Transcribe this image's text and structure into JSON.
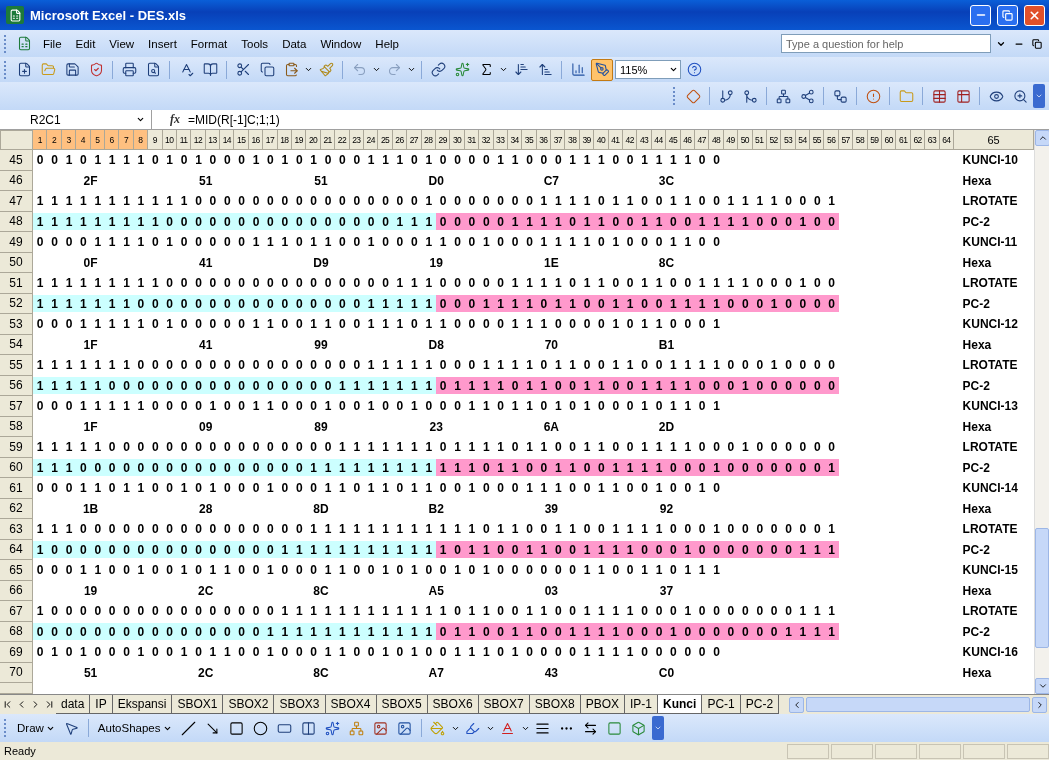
{
  "window": {
    "title": "Microsoft Excel - DES.xls"
  },
  "menu": [
    "File",
    "Edit",
    "View",
    "Insert",
    "Format",
    "Tools",
    "Data",
    "Window",
    "Help"
  ],
  "help_search": {
    "placeholder": "Type a question for help"
  },
  "toolbar": {
    "zoom": "115%"
  },
  "formula_bar": {
    "name_box": "R2C1",
    "function_button": "fx",
    "formula": "=MID(R[-1]C;1;1)"
  },
  "column_headers": [
    {
      "label": "1",
      "selected": true
    },
    {
      "label": "2",
      "selected": true
    },
    {
      "label": "3",
      "selected": true
    },
    {
      "label": "4",
      "selected": true
    },
    {
      "label": "5",
      "selected": true
    },
    {
      "label": "6",
      "selected": true
    },
    {
      "label": "7",
      "selected": true
    },
    {
      "label": "8",
      "selected": true
    },
    {
      "label": "9",
      "selected": false
    },
    {
      "label": "10",
      "selected": false
    },
    {
      "label": "11",
      "selected": false
    },
    {
      "label": "12",
      "selected": false
    },
    {
      "label": "13",
      "selected": false
    },
    {
      "label": "14",
      "selected": false
    },
    {
      "label": "15",
      "selected": false
    },
    {
      "label": "16",
      "selected": false
    },
    {
      "label": "17",
      "selected": false
    },
    {
      "label": "18",
      "selected": false
    },
    {
      "label": "19",
      "selected": false
    },
    {
      "label": "20",
      "selected": false
    },
    {
      "label": "21",
      "selected": false
    },
    {
      "label": "22",
      "selected": false
    },
    {
      "label": "23",
      "selected": false
    },
    {
      "label": "24",
      "selected": false
    },
    {
      "label": "25",
      "selected": false
    },
    {
      "label": "26",
      "selected": false
    },
    {
      "label": "27",
      "selected": false
    },
    {
      "label": "28",
      "selected": false
    },
    {
      "label": "29",
      "selected": false
    },
    {
      "label": "30",
      "selected": false
    },
    {
      "label": "31",
      "selected": false
    },
    {
      "label": "32",
      "selected": false
    },
    {
      "label": "33",
      "selected": false
    },
    {
      "label": "34",
      "selected": false
    },
    {
      "label": "35",
      "selected": false
    },
    {
      "label": "36",
      "selected": false
    },
    {
      "label": "37",
      "selected": false
    },
    {
      "label": "38",
      "selected": false
    },
    {
      "label": "39",
      "selected": false
    },
    {
      "label": "40",
      "selected": false
    },
    {
      "label": "41",
      "selected": false
    },
    {
      "label": "42",
      "selected": false
    },
    {
      "label": "43",
      "selected": false
    },
    {
      "label": "44",
      "selected": false
    },
    {
      "label": "45",
      "selected": false
    },
    {
      "label": "46",
      "selected": false
    },
    {
      "label": "47",
      "selected": false
    },
    {
      "label": "48",
      "selected": false
    },
    {
      "label": "49",
      "selected": false
    },
    {
      "label": "50",
      "selected": false
    },
    {
      "label": "51",
      "selected": false
    },
    {
      "label": "52",
      "selected": false
    },
    {
      "label": "53",
      "selected": false
    },
    {
      "label": "54",
      "selected": false
    },
    {
      "label": "55",
      "selected": false
    },
    {
      "label": "56",
      "selected": false
    },
    {
      "label": "57",
      "selected": false
    },
    {
      "label": "58",
      "selected": false
    },
    {
      "label": "59",
      "selected": false
    },
    {
      "label": "60",
      "selected": false
    },
    {
      "label": "61",
      "selected": false
    },
    {
      "label": "62",
      "selected": false
    },
    {
      "label": "63",
      "selected": false
    },
    {
      "label": "64",
      "selected": false
    },
    {
      "label": "65",
      "selected": false
    }
  ],
  "rows": [
    {
      "number": "45",
      "kind": "bits",
      "label": "KUNCI-10",
      "groups": [
        {
          "cells": [
            "0",
            "0",
            "1",
            "0",
            "1",
            "1",
            "1",
            "1",
            "0",
            "1",
            "0",
            "1",
            "0",
            "0",
            "0",
            "1",
            "0",
            "1",
            "0",
            "1",
            "0",
            "0",
            "0",
            "1",
            "1",
            "1",
            "0",
            "1",
            "0",
            "0",
            "0",
            "0",
            "1",
            "1",
            "0",
            "0",
            "0",
            "1",
            "1",
            "1",
            "0",
            "0",
            "1",
            "1",
            "1",
            "1",
            "0",
            "0"
          ]
        }
      ]
    },
    {
      "number": "46",
      "kind": "hex",
      "label": "Hexa",
      "values": [
        "2F",
        "51",
        "51",
        "D0",
        "C7",
        "3C"
      ]
    },
    {
      "number": "47",
      "kind": "bits",
      "label": "LROTATE",
      "groups": [
        {
          "cells": [
            "1",
            "1",
            "1",
            "1",
            "1",
            "1",
            "1",
            "1",
            "1",
            "1",
            "1",
            "0",
            "0",
            "0",
            "0",
            "0",
            "0",
            "0",
            "0",
            "0",
            "0",
            "0",
            "0",
            "0",
            "0",
            "0",
            "0",
            "1",
            "0",
            "0",
            "0",
            "0",
            "0",
            "0",
            "0",
            "1",
            "1",
            "1",
            "1",
            "0",
            "1",
            "1",
            "0",
            "0",
            "1",
            "1",
            "0",
            "0",
            "1",
            "1",
            "1",
            "1",
            "0",
            "0",
            "0",
            "1"
          ]
        }
      ]
    },
    {
      "number": "48",
      "kind": "bits",
      "label": "PC-2",
      "groups": [
        {
          "color": "#ccffff",
          "cells": [
            "1",
            "1",
            "1",
            "1",
            "1",
            "1",
            "1",
            "1",
            "1",
            "0",
            "0",
            "0",
            "0",
            "0",
            "0",
            "0",
            "0",
            "0",
            "0",
            "0",
            "0",
            "0",
            "0",
            "0",
            "0",
            "1",
            "1",
            "1"
          ]
        },
        {
          "color": "#ff99cc",
          "cells": [
            "0",
            "0",
            "0",
            "0",
            "0",
            "1",
            "1",
            "1",
            "1",
            "0",
            "1",
            "1",
            "0",
            "0",
            "1",
            "1",
            "0",
            "0",
            "1",
            "1",
            "1",
            "1",
            "0",
            "0",
            "0",
            "1",
            "0",
            "0"
          ]
        }
      ]
    },
    {
      "number": "49",
      "kind": "bits",
      "label": "KUNCI-11",
      "groups": [
        {
          "cells": [
            "0",
            "0",
            "0",
            "0",
            "1",
            "1",
            "1",
            "1",
            "0",
            "1",
            "0",
            "0",
            "0",
            "0",
            "0",
            "1",
            "1",
            "1",
            "0",
            "1",
            "1",
            "0",
            "0",
            "1",
            "0",
            "0",
            "0",
            "1",
            "1",
            "0",
            "0",
            "1",
            "0",
            "0",
            "0",
            "1",
            "1",
            "1",
            "1",
            "0",
            "1",
            "0",
            "0",
            "0",
            "1",
            "1",
            "0",
            "0"
          ]
        }
      ]
    },
    {
      "number": "50",
      "kind": "hex",
      "label": "Hexa",
      "values": [
        "0F",
        "41",
        "D9",
        "19",
        "1E",
        "8C"
      ]
    },
    {
      "number": "51",
      "kind": "bits",
      "label": "LROTATE",
      "groups": [
        {
          "cells": [
            "1",
            "1",
            "1",
            "1",
            "1",
            "1",
            "1",
            "1",
            "1",
            "0",
            "0",
            "0",
            "0",
            "0",
            "0",
            "0",
            "0",
            "0",
            "0",
            "0",
            "0",
            "0",
            "0",
            "0",
            "0",
            "1",
            "1",
            "1",
            "0",
            "0",
            "0",
            "0",
            "0",
            "1",
            "1",
            "1",
            "1",
            "0",
            "1",
            "1",
            "0",
            "0",
            "1",
            "1",
            "0",
            "0",
            "1",
            "1",
            "1",
            "1",
            "0",
            "0",
            "0",
            "1",
            "0",
            "0"
          ]
        }
      ]
    },
    {
      "number": "52",
      "kind": "bits",
      "label": "PC-2",
      "groups": [
        {
          "color": "#ccffff",
          "cells": [
            "1",
            "1",
            "1",
            "1",
            "1",
            "1",
            "1",
            "0",
            "0",
            "0",
            "0",
            "0",
            "0",
            "0",
            "0",
            "0",
            "0",
            "0",
            "0",
            "0",
            "0",
            "0",
            "0",
            "1",
            "1",
            "1",
            "1",
            "1"
          ]
        },
        {
          "color": "#ff99cc",
          "cells": [
            "0",
            "0",
            "0",
            "1",
            "1",
            "1",
            "1",
            "0",
            "1",
            "1",
            "0",
            "0",
            "1",
            "1",
            "0",
            "0",
            "1",
            "1",
            "1",
            "1",
            "0",
            "0",
            "0",
            "1",
            "0",
            "0",
            "0",
            "0"
          ]
        }
      ]
    },
    {
      "number": "53",
      "kind": "bits",
      "label": "KUNCI-12",
      "groups": [
        {
          "cells": [
            "0",
            "0",
            "0",
            "1",
            "1",
            "1",
            "1",
            "1",
            "0",
            "1",
            "0",
            "0",
            "0",
            "0",
            "0",
            "1",
            "1",
            "0",
            "0",
            "1",
            "1",
            "0",
            "0",
            "1",
            "1",
            "1",
            "0",
            "1",
            "1",
            "0",
            "0",
            "0",
            "0",
            "1",
            "1",
            "1",
            "0",
            "0",
            "0",
            "0",
            "1",
            "0",
            "1",
            "1",
            "0",
            "0",
            "0",
            "1"
          ]
        }
      ]
    },
    {
      "number": "54",
      "kind": "hex",
      "label": "Hexa",
      "values": [
        "1F",
        "41",
        "99",
        "D8",
        "70",
        "B1"
      ]
    },
    {
      "number": "55",
      "kind": "bits",
      "label": "LROTATE",
      "groups": [
        {
          "cells": [
            "1",
            "1",
            "1",
            "1",
            "1",
            "1",
            "1",
            "0",
            "0",
            "0",
            "0",
            "0",
            "0",
            "0",
            "0",
            "0",
            "0",
            "0",
            "0",
            "0",
            "0",
            "0",
            "0",
            "1",
            "1",
            "1",
            "1",
            "1",
            "0",
            "0",
            "0",
            "1",
            "1",
            "1",
            "1",
            "0",
            "1",
            "1",
            "0",
            "0",
            "1",
            "1",
            "0",
            "0",
            "1",
            "1",
            "1",
            "1",
            "0",
            "0",
            "0",
            "1",
            "0",
            "0",
            "0",
            "0"
          ]
        }
      ]
    },
    {
      "number": "56",
      "kind": "bits",
      "label": "PC-2",
      "groups": [
        {
          "color": "#ccffff",
          "cells": [
            "1",
            "1",
            "1",
            "1",
            "1",
            "0",
            "0",
            "0",
            "0",
            "0",
            "0",
            "0",
            "0",
            "0",
            "0",
            "0",
            "0",
            "0",
            "0",
            "0",
            "0",
            "1",
            "1",
            "1",
            "1",
            "1",
            "1",
            "1"
          ]
        },
        {
          "color": "#ff99cc",
          "cells": [
            "0",
            "1",
            "1",
            "1",
            "1",
            "0",
            "1",
            "1",
            "0",
            "0",
            "1",
            "1",
            "0",
            "0",
            "1",
            "1",
            "1",
            "1",
            "0",
            "0",
            "0",
            "1",
            "0",
            "0",
            "0",
            "0",
            "0",
            "0"
          ]
        }
      ]
    },
    {
      "number": "57",
      "kind": "bits",
      "label": "KUNCI-13",
      "groups": [
        {
          "cells": [
            "0",
            "0",
            "0",
            "1",
            "1",
            "1",
            "1",
            "1",
            "0",
            "0",
            "0",
            "0",
            "1",
            "0",
            "0",
            "1",
            "1",
            "0",
            "0",
            "0",
            "1",
            "0",
            "0",
            "1",
            "0",
            "0",
            "1",
            "0",
            "0",
            "0",
            "1",
            "1",
            "0",
            "1",
            "1",
            "0",
            "1",
            "0",
            "1",
            "0",
            "0",
            "0",
            "1",
            "0",
            "1",
            "1",
            "0",
            "1"
          ]
        }
      ]
    },
    {
      "number": "58",
      "kind": "hex",
      "label": "Hexa",
      "values": [
        "1F",
        "09",
        "89",
        "23",
        "6A",
        "2D"
      ]
    },
    {
      "number": "59",
      "kind": "bits",
      "label": "LROTATE",
      "groups": [
        {
          "cells": [
            "1",
            "1",
            "1",
            "1",
            "1",
            "0",
            "0",
            "0",
            "0",
            "0",
            "0",
            "0",
            "0",
            "0",
            "0",
            "0",
            "0",
            "0",
            "0",
            "0",
            "0",
            "1",
            "1",
            "1",
            "1",
            "1",
            "1",
            "1",
            "0",
            "1",
            "1",
            "1",
            "1",
            "0",
            "1",
            "1",
            "0",
            "0",
            "1",
            "1",
            "0",
            "0",
            "1",
            "1",
            "1",
            "1",
            "0",
            "0",
            "0",
            "1",
            "0",
            "0",
            "0",
            "0",
            "0",
            "0"
          ]
        }
      ]
    },
    {
      "number": "60",
      "kind": "bits",
      "label": "PC-2",
      "groups": [
        {
          "color": "#ccffff",
          "cells": [
            "1",
            "1",
            "1",
            "0",
            "0",
            "0",
            "0",
            "0",
            "0",
            "0",
            "0",
            "0",
            "0",
            "0",
            "0",
            "0",
            "0",
            "0",
            "0",
            "1",
            "1",
            "1",
            "1",
            "1",
            "1",
            "1",
            "1",
            "1"
          ]
        },
        {
          "color": "#ff99cc",
          "cells": [
            "1",
            "1",
            "1",
            "0",
            "1",
            "1",
            "0",
            "0",
            "1",
            "1",
            "0",
            "0",
            "1",
            "1",
            "1",
            "1",
            "0",
            "0",
            "0",
            "1",
            "0",
            "0",
            "0",
            "0",
            "0",
            "0",
            "0",
            "1"
          ]
        }
      ]
    },
    {
      "number": "61",
      "kind": "bits",
      "label": "KUNCI-14",
      "groups": [
        {
          "cells": [
            "0",
            "0",
            "0",
            "1",
            "1",
            "0",
            "1",
            "1",
            "0",
            "0",
            "1",
            "0",
            "1",
            "0",
            "0",
            "0",
            "1",
            "0",
            "0",
            "0",
            "1",
            "1",
            "0",
            "1",
            "1",
            "0",
            "1",
            "1",
            "0",
            "0",
            "1",
            "0",
            "0",
            "0",
            "1",
            "1",
            "1",
            "0",
            "0",
            "1",
            "1",
            "0",
            "0",
            "1",
            "0",
            "0",
            "1",
            "0"
          ]
        }
      ]
    },
    {
      "number": "62",
      "kind": "hex",
      "label": "Hexa",
      "values": [
        "1B",
        "28",
        "8D",
        "B2",
        "39",
        "92"
      ]
    },
    {
      "number": "63",
      "kind": "bits",
      "label": "LROTATE",
      "groups": [
        {
          "cells": [
            "1",
            "1",
            "1",
            "0",
            "0",
            "0",
            "0",
            "0",
            "0",
            "0",
            "0",
            "0",
            "0",
            "0",
            "0",
            "0",
            "0",
            "0",
            "0",
            "1",
            "1",
            "1",
            "1",
            "1",
            "1",
            "1",
            "1",
            "1",
            "1",
            "1",
            "1",
            "0",
            "1",
            "1",
            "0",
            "0",
            "1",
            "1",
            "0",
            "0",
            "1",
            "1",
            "1",
            "1",
            "0",
            "0",
            "0",
            "1",
            "0",
            "0",
            "0",
            "0",
            "0",
            "0",
            "0",
            "1"
          ]
        }
      ]
    },
    {
      "number": "64",
      "kind": "bits",
      "label": "PC-2",
      "groups": [
        {
          "color": "#ccffff",
          "cells": [
            "1",
            "0",
            "0",
            "0",
            "0",
            "0",
            "0",
            "0",
            "0",
            "0",
            "0",
            "0",
            "0",
            "0",
            "0",
            "0",
            "0",
            "1",
            "1",
            "1",
            "1",
            "1",
            "1",
            "1",
            "1",
            "1",
            "1",
            "1"
          ]
        },
        {
          "color": "#ff99cc",
          "cells": [
            "1",
            "0",
            "1",
            "1",
            "0",
            "0",
            "1",
            "1",
            "0",
            "0",
            "1",
            "1",
            "1",
            "1",
            "0",
            "0",
            "0",
            "1",
            "0",
            "0",
            "0",
            "0",
            "0",
            "0",
            "0",
            "1",
            "1",
            "1"
          ]
        }
      ]
    },
    {
      "number": "65",
      "kind": "bits",
      "label": "KUNCI-15",
      "groups": [
        {
          "cells": [
            "0",
            "0",
            "0",
            "1",
            "1",
            "0",
            "0",
            "1",
            "0",
            "0",
            "1",
            "0",
            "1",
            "1",
            "0",
            "0",
            "1",
            "0",
            "0",
            "0",
            "1",
            "1",
            "0",
            "0",
            "1",
            "0",
            "1",
            "0",
            "0",
            "1",
            "0",
            "1",
            "0",
            "0",
            "0",
            "0",
            "0",
            "0",
            "1",
            "1",
            "0",
            "0",
            "1",
            "1",
            "0",
            "1",
            "1",
            "1"
          ]
        }
      ]
    },
    {
      "number": "66",
      "kind": "hex",
      "label": "Hexa",
      "values": [
        "19",
        "2C",
        "8C",
        "A5",
        "03",
        "37"
      ]
    },
    {
      "number": "67",
      "kind": "bits",
      "label": "LROTATE",
      "groups": [
        {
          "cells": [
            "1",
            "0",
            "0",
            "0",
            "0",
            "0",
            "0",
            "0",
            "0",
            "0",
            "0",
            "0",
            "0",
            "0",
            "0",
            "0",
            "0",
            "1",
            "1",
            "1",
            "1",
            "1",
            "1",
            "1",
            "1",
            "1",
            "1",
            "1",
            "1",
            "0",
            "1",
            "1",
            "0",
            "0",
            "1",
            "1",
            "0",
            "0",
            "1",
            "1",
            "1",
            "1",
            "0",
            "0",
            "0",
            "1",
            "0",
            "0",
            "0",
            "0",
            "0",
            "0",
            "0",
            "1",
            "1",
            "1"
          ]
        }
      ]
    },
    {
      "number": "68",
      "kind": "bits",
      "label": "PC-2",
      "groups": [
        {
          "color": "#ccffff",
          "cells": [
            "0",
            "0",
            "0",
            "0",
            "0",
            "0",
            "0",
            "0",
            "0",
            "0",
            "0",
            "0",
            "0",
            "0",
            "0",
            "0",
            "1",
            "1",
            "1",
            "1",
            "1",
            "1",
            "1",
            "1",
            "1",
            "1",
            "1",
            "1"
          ]
        },
        {
          "color": "#ff99cc",
          "cells": [
            "0",
            "1",
            "1",
            "0",
            "0",
            "1",
            "1",
            "0",
            "0",
            "1",
            "1",
            "1",
            "1",
            "0",
            "0",
            "0",
            "1",
            "0",
            "0",
            "0",
            "0",
            "0",
            "0",
            "0",
            "1",
            "1",
            "1",
            "1"
          ]
        }
      ]
    },
    {
      "number": "69",
      "kind": "bits",
      "label": "KUNCI-16",
      "groups": [
        {
          "cells": [
            "0",
            "1",
            "0",
            "1",
            "0",
            "0",
            "0",
            "1",
            "0",
            "0",
            "1",
            "0",
            "1",
            "1",
            "0",
            "0",
            "1",
            "0",
            "0",
            "0",
            "1",
            "1",
            "0",
            "0",
            "1",
            "0",
            "1",
            "0",
            "0",
            "1",
            "1",
            "1",
            "0",
            "1",
            "0",
            "0",
            "0",
            "0",
            "1",
            "1",
            "1",
            "1",
            "0",
            "0",
            "0",
            "0",
            "0",
            "0"
          ]
        }
      ]
    },
    {
      "number": "70",
      "kind": "hex",
      "label": "Hexa",
      "values": [
        "51",
        "2C",
        "8C",
        "A7",
        "43",
        "C0"
      ]
    }
  ],
  "sheet_tabs": [
    {
      "label": "data",
      "selected": false
    },
    {
      "label": "IP",
      "selected": false
    },
    {
      "label": "Ekspansi",
      "selected": false
    },
    {
      "label": "SBOX1",
      "selected": false
    },
    {
      "label": "SBOX2",
      "selected": false
    },
    {
      "label": "SBOX3",
      "selected": false
    },
    {
      "label": "SBOX4",
      "selected": false
    },
    {
      "label": "SBOX5",
      "selected": false
    },
    {
      "label": "SBOX6",
      "selected": false
    },
    {
      "label": "SBOX7",
      "selected": false
    },
    {
      "label": "SBOX8",
      "selected": false
    },
    {
      "label": "PBOX",
      "selected": false
    },
    {
      "label": "IP-1",
      "selected": false
    },
    {
      "label": "Kunci",
      "selected": true
    },
    {
      "label": "PC-1",
      "selected": false
    },
    {
      "label": "PC-2",
      "selected": false
    }
  ],
  "draw_toolbar": {
    "draw": "Draw",
    "autoshapes": "AutoShapes"
  },
  "status_bar": {
    "text": "Ready"
  }
}
